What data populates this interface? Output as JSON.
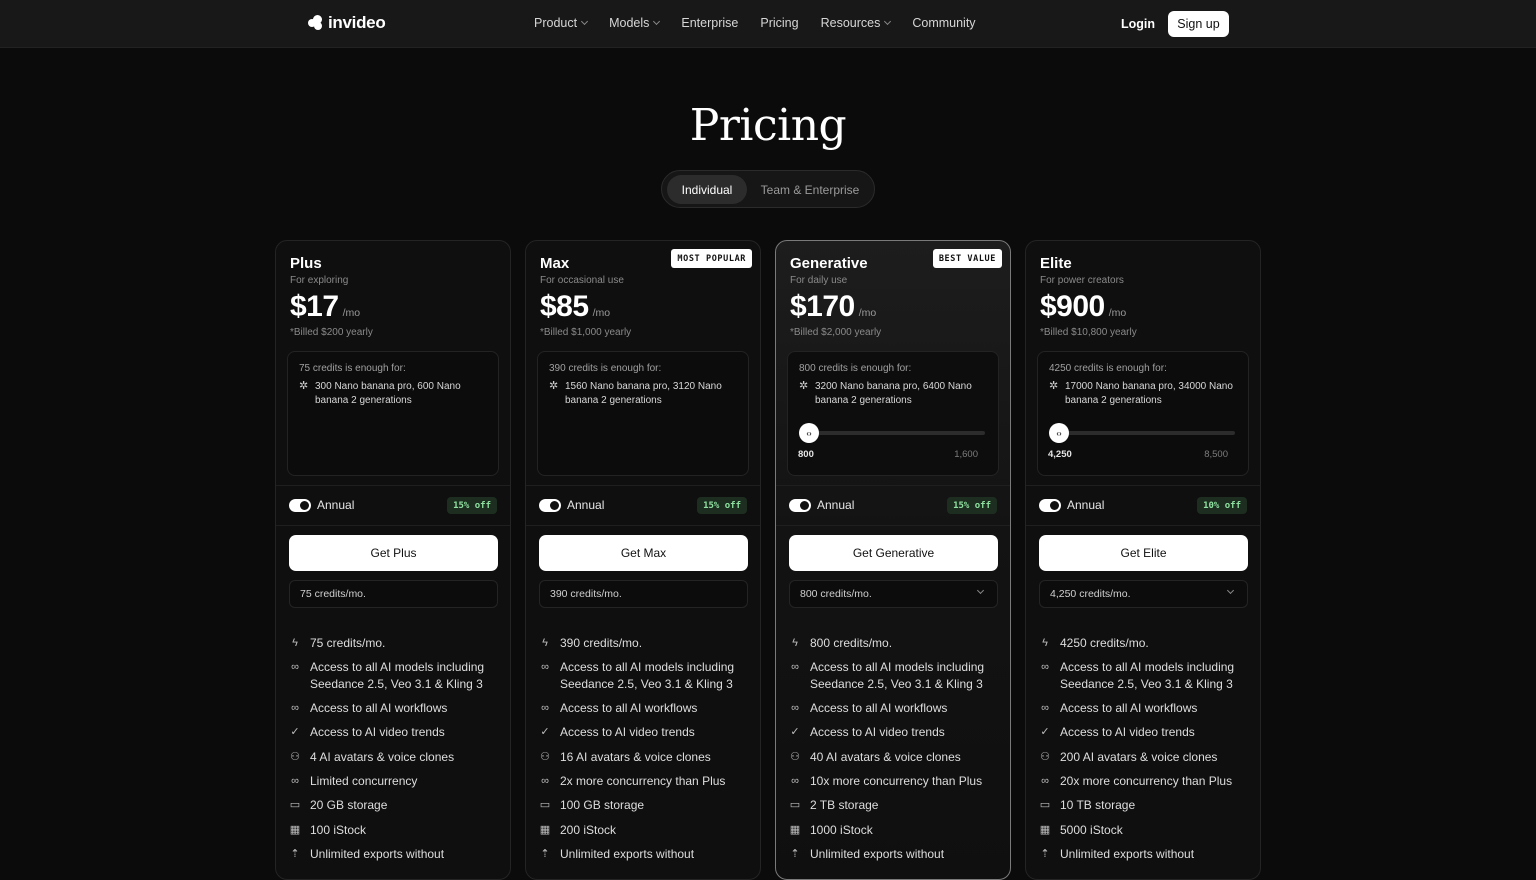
{
  "nav": {
    "logo": "invideo",
    "links": [
      {
        "label": "Product",
        "dropdown": true
      },
      {
        "label": "Models",
        "dropdown": true
      },
      {
        "label": "Enterprise",
        "dropdown": false
      },
      {
        "label": "Pricing",
        "dropdown": false
      },
      {
        "label": "Resources",
        "dropdown": true
      },
      {
        "label": "Community",
        "dropdown": false
      }
    ],
    "login": "Login",
    "signup": "Sign up"
  },
  "hero": {
    "title": "Pricing",
    "tabs": [
      "Individual",
      "Team & Enterprise"
    ],
    "active_tab": "Individual"
  },
  "colors": {
    "background": "#0b0b0b",
    "accent_green": "#8fe0a0",
    "cta": "#ffffff"
  },
  "plans": [
    {
      "name": "Plus",
      "subtitle": "For exploring",
      "price": "$17",
      "per": "/mo",
      "billed": "*Billed $200 yearly",
      "badge": "",
      "credits_title": "75 credits is enough for:",
      "credits_line": "300 Nano banana pro, 600 Nano banana 2 generations",
      "slider": null,
      "toggle_label": "Annual",
      "discount": "15% off",
      "cta": "Get Plus",
      "select": "75 credits/mo.",
      "select_dropdown": false,
      "features": [
        "75 credits/mo.",
        "Access to all AI models including Seedance 2.5, Veo 3.1 & Kling 3",
        "Access to all AI workflows",
        "Access to AI video trends",
        "4 AI avatars & voice clones",
        "Limited concurrency",
        "20 GB storage",
        "100 iStock",
        "Unlimited exports without"
      ]
    },
    {
      "name": "Max",
      "subtitle": "For occasional use",
      "price": "$85",
      "per": "/mo",
      "billed": "*Billed $1,000 yearly",
      "badge": "MOST POPULAR",
      "credits_title": "390 credits is enough for:",
      "credits_line": "1560 Nano banana pro, 3120 Nano banana 2 generations",
      "slider": null,
      "toggle_label": "Annual",
      "discount": "15% off",
      "cta": "Get Max",
      "select": "390 credits/mo.",
      "select_dropdown": false,
      "features": [
        "390 credits/mo.",
        "Access to all AI models including Seedance 2.5, Veo 3.1 & Kling 3",
        "Access to all AI workflows",
        "Access to AI video trends",
        "16 AI avatars & voice clones",
        "2x more concurrency than Plus",
        "100 GB storage",
        "200 iStock",
        "Unlimited exports without"
      ]
    },
    {
      "name": "Generative",
      "subtitle": "For daily use",
      "price": "$170",
      "per": "/mo",
      "billed": "*Billed $2,000 yearly",
      "badge": "BEST VALUE",
      "credits_title": "800 credits is enough for:",
      "credits_line": "3200 Nano banana pro, 6400 Nano banana 2 generations",
      "slider": {
        "min": "800",
        "max": "1,600",
        "value": 0
      },
      "toggle_label": "Annual",
      "discount": "15% off",
      "cta": "Get Generative",
      "select": "800 credits/mo.",
      "select_dropdown": true,
      "features": [
        "800 credits/mo.",
        "Access to all AI models including Seedance 2.5, Veo 3.1 & Kling 3",
        "Access to all AI workflows",
        "Access to AI video trends",
        "40 AI avatars & voice clones",
        "10x more concurrency than Plus",
        "2 TB storage",
        "1000 iStock",
        "Unlimited exports without"
      ]
    },
    {
      "name": "Elite",
      "subtitle": "For power creators",
      "price": "$900",
      "per": "/mo",
      "billed": "*Billed $10,800 yearly",
      "badge": "",
      "credits_title": "4250 credits is enough for:",
      "credits_line": "17000 Nano banana pro, 34000 Nano banana 2 generations",
      "slider": {
        "min": "4,250",
        "max": "8,500",
        "value": 0
      },
      "toggle_label": "Annual",
      "discount": "10% off",
      "cta": "Get Elite",
      "select": "4,250 credits/mo.",
      "select_dropdown": true,
      "features": [
        "4250 credits/mo.",
        "Access to all AI models including Seedance 2.5, Veo 3.1 & Kling 3",
        "Access to all AI workflows",
        "Access to AI video trends",
        "200 AI avatars & voice clones",
        "20x more concurrency than Plus",
        "10 TB storage",
        "5000 iStock",
        "Unlimited exports without"
      ]
    }
  ],
  "feature_icons": [
    "bolt-icon",
    "link-icon",
    "link-icon",
    "check-icon",
    "users-icon",
    "link-icon",
    "storage-icon",
    "film-icon",
    "export-icon"
  ]
}
